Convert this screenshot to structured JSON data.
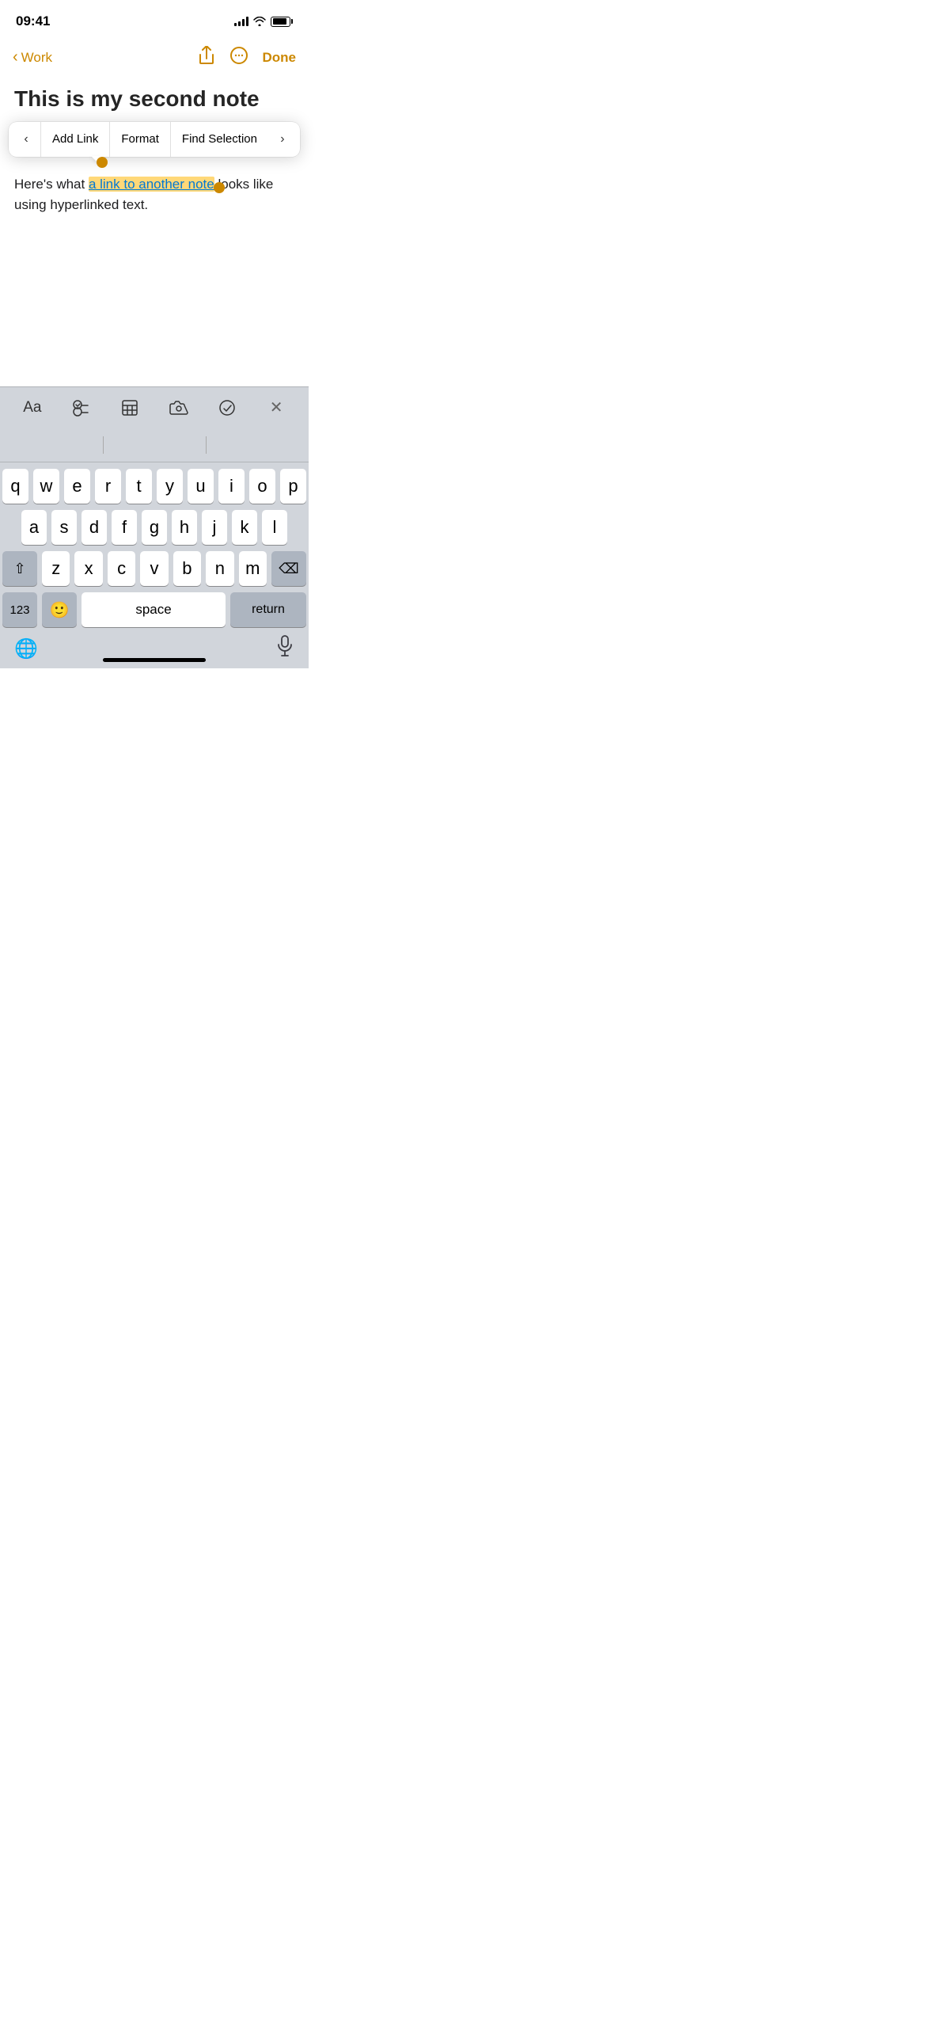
{
  "statusBar": {
    "time": "09:41"
  },
  "navBar": {
    "backLabel": "Work",
    "doneLabel": "Done"
  },
  "noteTitle": "This is my second note",
  "contextMenu": {
    "prevArrow": "‹",
    "nextArrow": "›",
    "items": [
      "Add Link",
      "Format",
      "Find Selection"
    ]
  },
  "noteContent": {
    "text": "a link to another note",
    "before": "Here's what ",
    "after": " looks like using hyperlinked text."
  },
  "toolbar": {
    "buttons": [
      "Aa",
      "checklist",
      "table",
      "camera",
      "marker",
      "×"
    ]
  },
  "keyboard": {
    "rows": [
      [
        "q",
        "w",
        "e",
        "r",
        "t",
        "y",
        "u",
        "i",
        "o",
        "p"
      ],
      [
        "a",
        "s",
        "d",
        "f",
        "g",
        "h",
        "j",
        "k",
        "l"
      ],
      [
        "z",
        "x",
        "c",
        "v",
        "b",
        "n",
        "m"
      ]
    ],
    "spaceLabel": "space",
    "returnLabel": "return",
    "numbersLabel": "123"
  },
  "colors": {
    "accent": "#CC8800",
    "highlight": "#FFD878",
    "link": "#0078d4"
  }
}
